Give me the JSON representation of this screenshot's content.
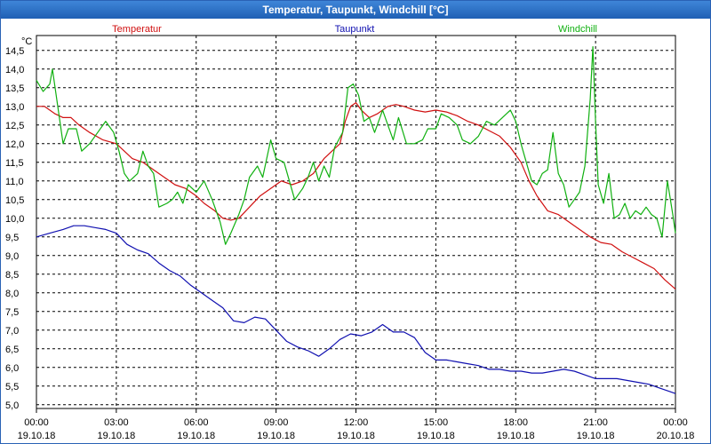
{
  "window": {
    "title": "Temperatur, Taupunkt, Windchill [°C]"
  },
  "chart_data": {
    "type": "line",
    "title": "Temperatur, Taupunkt, Windchill [°C]",
    "ylabel": "°C",
    "ylim": [
      4.9,
      14.9
    ],
    "xlim": [
      0,
      24
    ],
    "grid": true,
    "legend_position": "top",
    "y_ticks": [
      "5,0",
      "5,5",
      "6,0",
      "6,5",
      "7,0",
      "7,5",
      "8,0",
      "8,5",
      "9,0",
      "9,5",
      "10,0",
      "10,5",
      "11,0",
      "11,5",
      "12,0",
      "12,5",
      "13,0",
      "13,5",
      "14,0",
      "14,5"
    ],
    "x_ticks": [
      {
        "time": "00:00",
        "date": "19.10.18"
      },
      {
        "time": "03:00",
        "date": "19.10.18"
      },
      {
        "time": "06:00",
        "date": "19.10.18"
      },
      {
        "time": "09:00",
        "date": "19.10.18"
      },
      {
        "time": "12:00",
        "date": "19.10.18"
      },
      {
        "time": "15:00",
        "date": "19.10.18"
      },
      {
        "time": "18:00",
        "date": "19.10.18"
      },
      {
        "time": "21:00",
        "date": "19.10.18"
      },
      {
        "time": "00:00",
        "date": "20.10.18"
      }
    ],
    "series": [
      {
        "name": "Temperatur",
        "color": "#d01010",
        "points": [
          [
            0,
            13.0
          ],
          [
            0.3,
            13.0
          ],
          [
            0.7,
            12.8
          ],
          [
            1.0,
            12.7
          ],
          [
            1.3,
            12.7
          ],
          [
            1.6,
            12.5
          ],
          [
            2.0,
            12.3
          ],
          [
            2.5,
            12.1
          ],
          [
            3.0,
            12.0
          ],
          [
            3.3,
            11.8
          ],
          [
            3.6,
            11.6
          ],
          [
            4.0,
            11.5
          ],
          [
            4.4,
            11.3
          ],
          [
            4.8,
            11.1
          ],
          [
            5.2,
            10.9
          ],
          [
            5.6,
            10.8
          ],
          [
            6.0,
            10.6
          ],
          [
            6.3,
            10.4
          ],
          [
            6.7,
            10.2
          ],
          [
            7.0,
            10.0
          ],
          [
            7.3,
            9.95
          ],
          [
            7.6,
            10.0
          ],
          [
            8.0,
            10.3
          ],
          [
            8.4,
            10.6
          ],
          [
            8.8,
            10.8
          ],
          [
            9.2,
            11.0
          ],
          [
            9.6,
            10.9
          ],
          [
            10.0,
            11.0
          ],
          [
            10.4,
            11.2
          ],
          [
            10.8,
            11.6
          ],
          [
            11.1,
            11.8
          ],
          [
            11.4,
            12.0
          ],
          [
            11.6,
            12.6
          ],
          [
            11.8,
            13.0
          ],
          [
            12.0,
            13.1
          ],
          [
            12.2,
            12.9
          ],
          [
            12.5,
            12.7
          ],
          [
            12.8,
            12.8
          ],
          [
            13.2,
            13.0
          ],
          [
            13.5,
            13.05
          ],
          [
            13.8,
            13.0
          ],
          [
            14.2,
            12.9
          ],
          [
            14.6,
            12.85
          ],
          [
            15.0,
            12.9
          ],
          [
            15.4,
            12.85
          ],
          [
            15.8,
            12.75
          ],
          [
            16.2,
            12.6
          ],
          [
            16.6,
            12.5
          ],
          [
            17.0,
            12.35
          ],
          [
            17.4,
            12.2
          ],
          [
            17.8,
            11.9
          ],
          [
            18.2,
            11.5
          ],
          [
            18.5,
            11.0
          ],
          [
            18.8,
            10.6
          ],
          [
            19.2,
            10.2
          ],
          [
            19.6,
            10.1
          ],
          [
            20.0,
            9.9
          ],
          [
            20.4,
            9.7
          ],
          [
            20.8,
            9.5
          ],
          [
            21.2,
            9.35
          ],
          [
            21.6,
            9.3
          ],
          [
            22.0,
            9.1
          ],
          [
            22.4,
            8.95
          ],
          [
            22.8,
            8.8
          ],
          [
            23.2,
            8.65
          ],
          [
            23.6,
            8.35
          ],
          [
            24.0,
            8.1
          ]
        ]
      },
      {
        "name": "Taupunkt",
        "color": "#1010b0",
        "points": [
          [
            0,
            9.5
          ],
          [
            0.5,
            9.6
          ],
          [
            1.0,
            9.7
          ],
          [
            1.4,
            9.8
          ],
          [
            1.8,
            9.8
          ],
          [
            2.2,
            9.75
          ],
          [
            2.6,
            9.7
          ],
          [
            3.0,
            9.6
          ],
          [
            3.4,
            9.3
          ],
          [
            3.8,
            9.15
          ],
          [
            4.2,
            9.05
          ],
          [
            4.6,
            8.8
          ],
          [
            5.0,
            8.6
          ],
          [
            5.4,
            8.45
          ],
          [
            5.8,
            8.2
          ],
          [
            6.2,
            8.0
          ],
          [
            6.6,
            7.8
          ],
          [
            7.0,
            7.6
          ],
          [
            7.4,
            7.25
          ],
          [
            7.8,
            7.2
          ],
          [
            8.2,
            7.35
          ],
          [
            8.6,
            7.3
          ],
          [
            9.0,
            7.0
          ],
          [
            9.4,
            6.7
          ],
          [
            9.8,
            6.55
          ],
          [
            10.2,
            6.45
          ],
          [
            10.6,
            6.3
          ],
          [
            11.0,
            6.5
          ],
          [
            11.4,
            6.75
          ],
          [
            11.8,
            6.9
          ],
          [
            12.2,
            6.85
          ],
          [
            12.6,
            6.95
          ],
          [
            13.0,
            7.15
          ],
          [
            13.4,
            6.95
          ],
          [
            13.8,
            6.95
          ],
          [
            14.2,
            6.8
          ],
          [
            14.6,
            6.4
          ],
          [
            15.0,
            6.2
          ],
          [
            15.4,
            6.2
          ],
          [
            15.8,
            6.15
          ],
          [
            16.2,
            6.1
          ],
          [
            16.6,
            6.05
          ],
          [
            17.0,
            5.95
          ],
          [
            17.4,
            5.95
          ],
          [
            17.8,
            5.9
          ],
          [
            18.2,
            5.9
          ],
          [
            18.6,
            5.85
          ],
          [
            19.0,
            5.85
          ],
          [
            19.4,
            5.9
          ],
          [
            19.8,
            5.95
          ],
          [
            20.2,
            5.9
          ],
          [
            20.6,
            5.8
          ],
          [
            21.0,
            5.7
          ],
          [
            21.4,
            5.7
          ],
          [
            21.8,
            5.7
          ],
          [
            22.2,
            5.65
          ],
          [
            22.6,
            5.6
          ],
          [
            23.0,
            5.55
          ],
          [
            23.4,
            5.45
          ],
          [
            23.8,
            5.35
          ],
          [
            24.0,
            5.3
          ]
        ]
      },
      {
        "name": "Windchill",
        "color": "#10b010",
        "points": [
          [
            0,
            13.7
          ],
          [
            0.25,
            13.4
          ],
          [
            0.5,
            13.6
          ],
          [
            0.6,
            14.0
          ],
          [
            0.8,
            13.0
          ],
          [
            1.0,
            12.0
          ],
          [
            1.2,
            12.4
          ],
          [
            1.5,
            12.4
          ],
          [
            1.7,
            11.8
          ],
          [
            2.0,
            12.0
          ],
          [
            2.3,
            12.3
          ],
          [
            2.6,
            12.6
          ],
          [
            2.9,
            12.3
          ],
          [
            3.1,
            11.8
          ],
          [
            3.3,
            11.2
          ],
          [
            3.5,
            11.0
          ],
          [
            3.8,
            11.2
          ],
          [
            4.0,
            11.8
          ],
          [
            4.2,
            11.4
          ],
          [
            4.4,
            11.2
          ],
          [
            4.6,
            10.3
          ],
          [
            4.9,
            10.4
          ],
          [
            5.1,
            10.5
          ],
          [
            5.3,
            10.7
          ],
          [
            5.5,
            10.4
          ],
          [
            5.7,
            10.9
          ],
          [
            6.0,
            10.7
          ],
          [
            6.3,
            11.0
          ],
          [
            6.6,
            10.5
          ],
          [
            6.9,
            9.9
          ],
          [
            7.1,
            9.3
          ],
          [
            7.3,
            9.6
          ],
          [
            7.6,
            10.1
          ],
          [
            7.8,
            10.5
          ],
          [
            8.0,
            11.1
          ],
          [
            8.3,
            11.4
          ],
          [
            8.5,
            11.1
          ],
          [
            8.8,
            12.1
          ],
          [
            9.0,
            11.6
          ],
          [
            9.3,
            11.5
          ],
          [
            9.5,
            11.0
          ],
          [
            9.7,
            10.5
          ],
          [
            10.0,
            10.8
          ],
          [
            10.2,
            11.1
          ],
          [
            10.4,
            11.5
          ],
          [
            10.6,
            11.0
          ],
          [
            10.8,
            11.4
          ],
          [
            11.0,
            11.1
          ],
          [
            11.2,
            11.9
          ],
          [
            11.5,
            12.3
          ],
          [
            11.7,
            13.5
          ],
          [
            11.9,
            13.6
          ],
          [
            12.1,
            13.3
          ],
          [
            12.3,
            12.6
          ],
          [
            12.5,
            12.7
          ],
          [
            12.7,
            12.3
          ],
          [
            13.0,
            12.9
          ],
          [
            13.2,
            12.5
          ],
          [
            13.4,
            12.1
          ],
          [
            13.6,
            12.7
          ],
          [
            13.9,
            12.0
          ],
          [
            14.2,
            12.0
          ],
          [
            14.5,
            12.1
          ],
          [
            14.7,
            12.4
          ],
          [
            15.0,
            12.4
          ],
          [
            15.2,
            12.8
          ],
          [
            15.5,
            12.7
          ],
          [
            15.8,
            12.5
          ],
          [
            16.0,
            12.1
          ],
          [
            16.3,
            12.0
          ],
          [
            16.6,
            12.2
          ],
          [
            16.9,
            12.6
          ],
          [
            17.2,
            12.5
          ],
          [
            17.5,
            12.7
          ],
          [
            17.8,
            12.9
          ],
          [
            18.0,
            12.6
          ],
          [
            18.2,
            12.0
          ],
          [
            18.4,
            11.5
          ],
          [
            18.6,
            11.0
          ],
          [
            18.8,
            10.9
          ],
          [
            19.0,
            11.2
          ],
          [
            19.2,
            11.3
          ],
          [
            19.4,
            12.3
          ],
          [
            19.6,
            11.2
          ],
          [
            19.8,
            10.9
          ],
          [
            20.0,
            10.3
          ],
          [
            20.2,
            10.5
          ],
          [
            20.4,
            10.7
          ],
          [
            20.6,
            11.4
          ],
          [
            20.8,
            13.2
          ],
          [
            20.9,
            14.6
          ],
          [
            21.0,
            12.6
          ],
          [
            21.1,
            10.9
          ],
          [
            21.3,
            10.4
          ],
          [
            21.5,
            11.2
          ],
          [
            21.7,
            10.0
          ],
          [
            21.9,
            10.1
          ],
          [
            22.1,
            10.4
          ],
          [
            22.3,
            10.0
          ],
          [
            22.5,
            10.2
          ],
          [
            22.7,
            10.1
          ],
          [
            22.9,
            10.3
          ],
          [
            23.1,
            10.1
          ],
          [
            23.3,
            10.0
          ],
          [
            23.5,
            9.5
          ],
          [
            23.7,
            11.0
          ],
          [
            23.9,
            10.1
          ],
          [
            24.0,
            9.6
          ]
        ]
      }
    ]
  }
}
